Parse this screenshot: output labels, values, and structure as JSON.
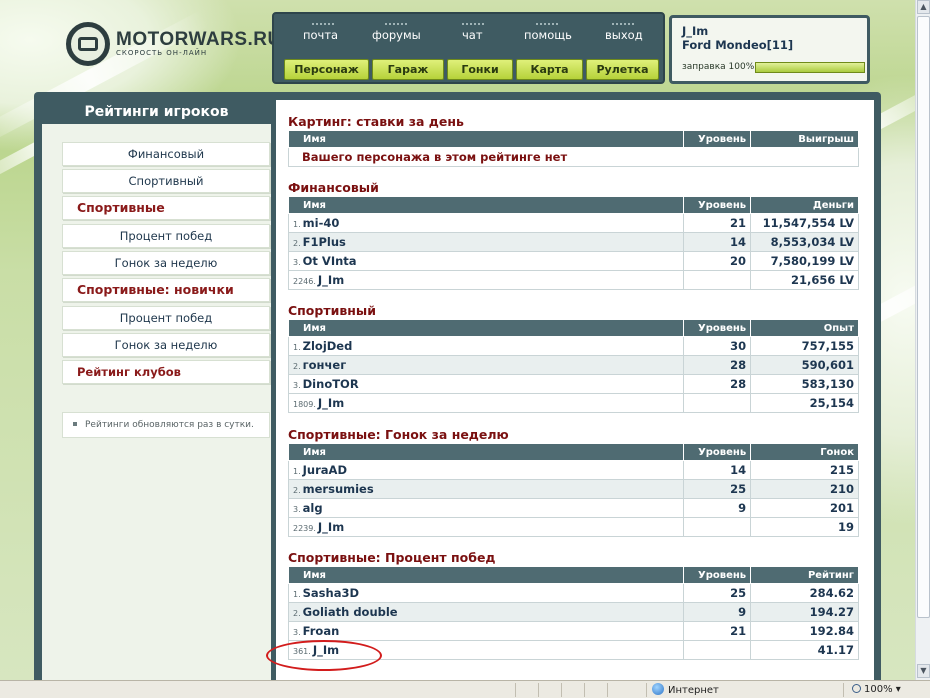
{
  "brand": {
    "name": "MOTORWARS.RU",
    "tagline": "СКОРОСТЬ ОН-ЛАЙН"
  },
  "topnav": [
    "почта",
    "форумы",
    "чат",
    "помощь",
    "выход"
  ],
  "topbuttons": [
    "Персонаж",
    "Гараж",
    "Гонки",
    "Карта",
    "Рулетка"
  ],
  "user": {
    "name": "J_Im",
    "car": "Ford Mondeo[11]",
    "fuel_label": "заправка 100%",
    "fuel_pct": 100
  },
  "sidebar": {
    "title": "Рейтинги игроков",
    "items": [
      {
        "label": "Финансовый"
      },
      {
        "label": "Спортивный"
      },
      {
        "label": "Спортивные"
      },
      {
        "label": "Процент побед"
      },
      {
        "label": "Гонок за неделю"
      },
      {
        "label": "Спортивные: новички"
      },
      {
        "label": "Процент побед"
      },
      {
        "label": "Гонок за неделю"
      },
      {
        "label": "Рейтинг клубов"
      }
    ],
    "note": "Рейтинги обновляются раз в сутки."
  },
  "sections": [
    {
      "title": "Картинг: ставки за день",
      "headers": [
        "Имя",
        "Уровень",
        "Выигрыш"
      ],
      "message": "Вашего персонажа в этом рейтинге нет"
    },
    {
      "title": "Финансовый",
      "headers": [
        "Имя",
        "Уровень",
        "Деньги"
      ],
      "rows": [
        {
          "rank": "1.",
          "name": "mi-40",
          "level": "21",
          "value": "11,547,554 LV"
        },
        {
          "rank": "2.",
          "name": "F1Plus",
          "level": "14",
          "value": "8,553,034 LV"
        },
        {
          "rank": "3.",
          "name": "Ot VInta",
          "level": "20",
          "value": "7,580,199 LV"
        },
        {
          "rank": "2246.",
          "name": "J_Im",
          "level": "",
          "value": "21,656 LV"
        }
      ]
    },
    {
      "title": "Спортивный",
      "headers": [
        "Имя",
        "Уровень",
        "Опыт"
      ],
      "rows": [
        {
          "rank": "1.",
          "name": "ZlojDed",
          "level": "30",
          "value": "757,155"
        },
        {
          "rank": "2.",
          "name": "гончег",
          "level": "28",
          "value": "590,601"
        },
        {
          "rank": "3.",
          "name": "DinoTOR",
          "level": "28",
          "value": "583,130"
        },
        {
          "rank": "1809.",
          "name": "J_Im",
          "level": "",
          "value": "25,154"
        }
      ]
    },
    {
      "title": "Спортивные: Гонок за неделю",
      "headers": [
        "Имя",
        "Уровень",
        "Гонок"
      ],
      "rows": [
        {
          "rank": "1.",
          "name": "JuraAD",
          "level": "14",
          "value": "215"
        },
        {
          "rank": "2.",
          "name": "mersumies",
          "level": "25",
          "value": "210"
        },
        {
          "rank": "3.",
          "name": "alg",
          "level": "9",
          "value": "201"
        },
        {
          "rank": "2239.",
          "name": "J_Im",
          "level": "",
          "value": "19"
        }
      ]
    },
    {
      "title": "Спортивные: Процент побед",
      "headers": [
        "Имя",
        "Уровень",
        "Рейтинг"
      ],
      "rows": [
        {
          "rank": "1.",
          "name": "Sasha3D",
          "level": "25",
          "value": "284.62"
        },
        {
          "rank": "2.",
          "name": "Goliath double",
          "level": "9",
          "value": "194.27"
        },
        {
          "rank": "3.",
          "name": "Froan",
          "level": "21",
          "value": "192.84"
        },
        {
          "rank": "361.",
          "name": "J_Im",
          "level": "",
          "value": "41.17"
        }
      ]
    }
  ],
  "statusbar": {
    "zone": "Интернет",
    "zoom": "100%"
  },
  "colors": {
    "accent_frame": "#3f5b62",
    "button_green": "#c6df55",
    "title_red": "#7a1010",
    "highlight_circle": "#d21c1c"
  }
}
